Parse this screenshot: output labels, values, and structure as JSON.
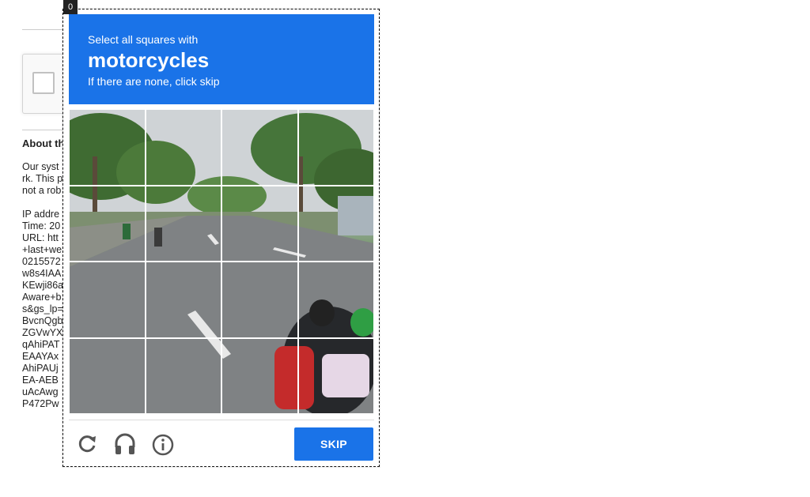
{
  "frame_badge": "0",
  "background_page": {
    "about_heading": "About th",
    "lines": [
      "Our syst",
      "rk. This p",
      "not a rob",
      "",
      "IP addre",
      "Time: 20",
      "URL: htt",
      "+last+we",
      "0215572",
      "w8s4IAA",
      "KEwji86a",
      "Aware+b",
      "s&gs_lp=",
      "BvcnQgb",
      "ZGVwYX",
      "qAhiPAT",
      "EAAYAx",
      "AhiPAUj",
      "EA-AEB",
      "uAcAwg",
      "P472Pw"
    ]
  },
  "challenge": {
    "instruction_prefix": "Select all squares with",
    "target": "motorcycles",
    "instruction_suffix": "If there are none, click skip",
    "grid_rows": 4,
    "grid_cols": 4,
    "skip_label": "SKIP",
    "icons": [
      "reload-icon",
      "audio-icon",
      "info-icon"
    ]
  },
  "colors": {
    "accent": "#1a73e8",
    "header_text": "#ffffff"
  }
}
